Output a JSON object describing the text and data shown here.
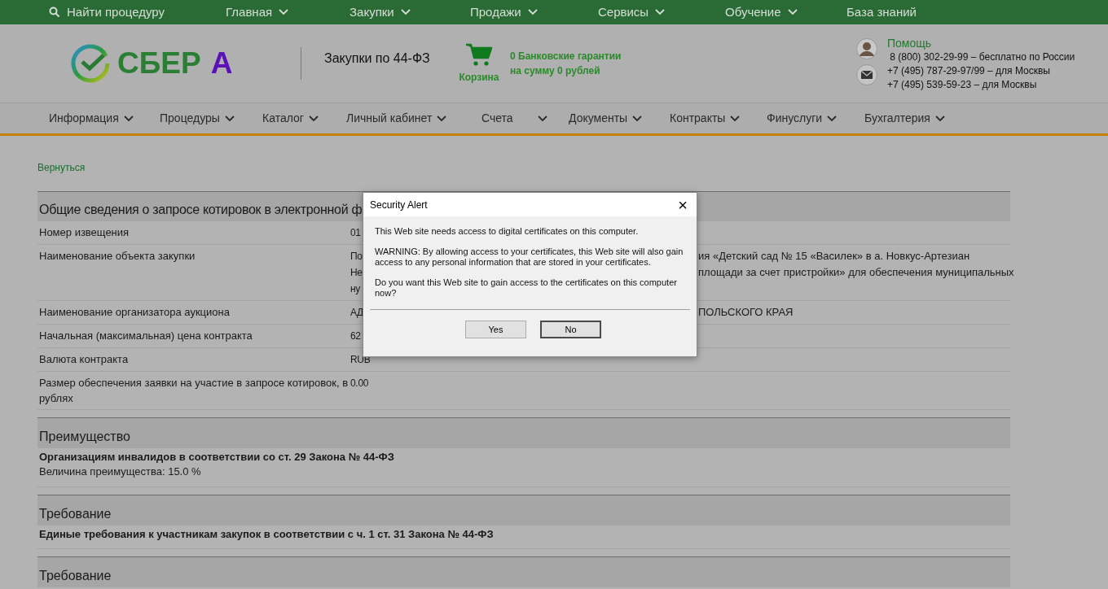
{
  "top_bar": {
    "search": "Найти процедуру",
    "items": [
      {
        "label": "Главная",
        "dropdown": true
      },
      {
        "label": "Закупки",
        "dropdown": true
      },
      {
        "label": "Продажи",
        "dropdown": true
      },
      {
        "label": "Сервисы",
        "dropdown": true
      },
      {
        "label": "Обучение",
        "dropdown": true
      },
      {
        "label": "База знаний",
        "dropdown": false
      }
    ]
  },
  "header": {
    "logo_main": "СБЕР",
    "logo_accent": "А",
    "section": "Закупки по 44-ФЗ",
    "cart": "Корзина",
    "guarantees": [
      "0 Банковские гарантии",
      "на сумму 0 рублей"
    ],
    "help": "Помощь",
    "phones": [
      " 8 (800) 302-29-99 – бесплатно по России",
      "+7 (495) 787-29-97/99 – для Москвы",
      "+7 (495) 539-59-23 – для Москвы"
    ]
  },
  "nav": [
    {
      "label": "Информация",
      "dropdown": true
    },
    {
      "label": "Процедуры",
      "dropdown": true
    },
    {
      "label": "Каталог",
      "dropdown": true
    },
    {
      "label": "Личный кабинет",
      "dropdown": true
    },
    {
      "label": "Счета",
      "dropdown": true
    },
    {
      "label": "Документы",
      "dropdown": true
    },
    {
      "label": "Контракты",
      "dropdown": true
    },
    {
      "label": "Финуслуги",
      "dropdown": true
    },
    {
      "label": "Бухгалтерия",
      "dropdown": true
    }
  ],
  "back_link": "Вернуться",
  "general": {
    "title": "Общие сведения о запросе котировок в электронной ф",
    "rows": [
      {
        "label": "Номер извещения",
        "value_lines": [
          {
            "start": "01"
          }
        ]
      },
      {
        "label": "Наименование объекта закупки",
        "value_lines": [
          {
            "start": "По",
            "end": "ия «Детский сад № 15 «Василек» в а. Новкус-Артезиан"
          },
          {
            "start": "Не",
            "end": "площади за счет пристройки» для обеспечения муниципальных"
          },
          {
            "start": "ну"
          }
        ]
      },
      {
        "label": "Наименование организатора аукциона",
        "value_lines": [
          {
            "start": "АД",
            "end": "ПОЛЬСКОГО КРАЯ"
          }
        ]
      },
      {
        "label": "Начальная (максимальная) цена контракта",
        "value_lines": [
          {
            "start": "62"
          }
        ]
      },
      {
        "label": "Валюта контракта",
        "value_lines": [
          {
            "start": "RUB"
          }
        ]
      },
      {
        "label": "Размер обеспечения заявки на участие в запросе котировок, в рублях",
        "value_lines": [
          {
            "start": "0.00"
          }
        ]
      }
    ]
  },
  "sections": [
    {
      "title": "Преимущество",
      "heading": "Организациям инвалидов в соответствии со ст. 29 Закона № 44-ФЗ",
      "detail": "Величина преимущества: 15.0 %"
    },
    {
      "title": "Требование",
      "heading": "Единые требования к участникам закупок в соответствии с ч. 1 ст. 31 Закона № 44-ФЗ"
    },
    {
      "title": "Требование"
    }
  ],
  "dialog": {
    "title": "Security Alert",
    "close": "×",
    "paragraphs": [
      "This Web site needs access to digital certificates on this computer.",
      "WARNING: By allowing access to your certificates, this Web site will also gain access to any personal information that are stored in your certificates.",
      "Do you want this Web site to gain access to the certificates on this computer now?"
    ],
    "buttons": [
      {
        "label": "Yes",
        "default": false
      },
      {
        "label": "No",
        "default": true
      }
    ]
  }
}
